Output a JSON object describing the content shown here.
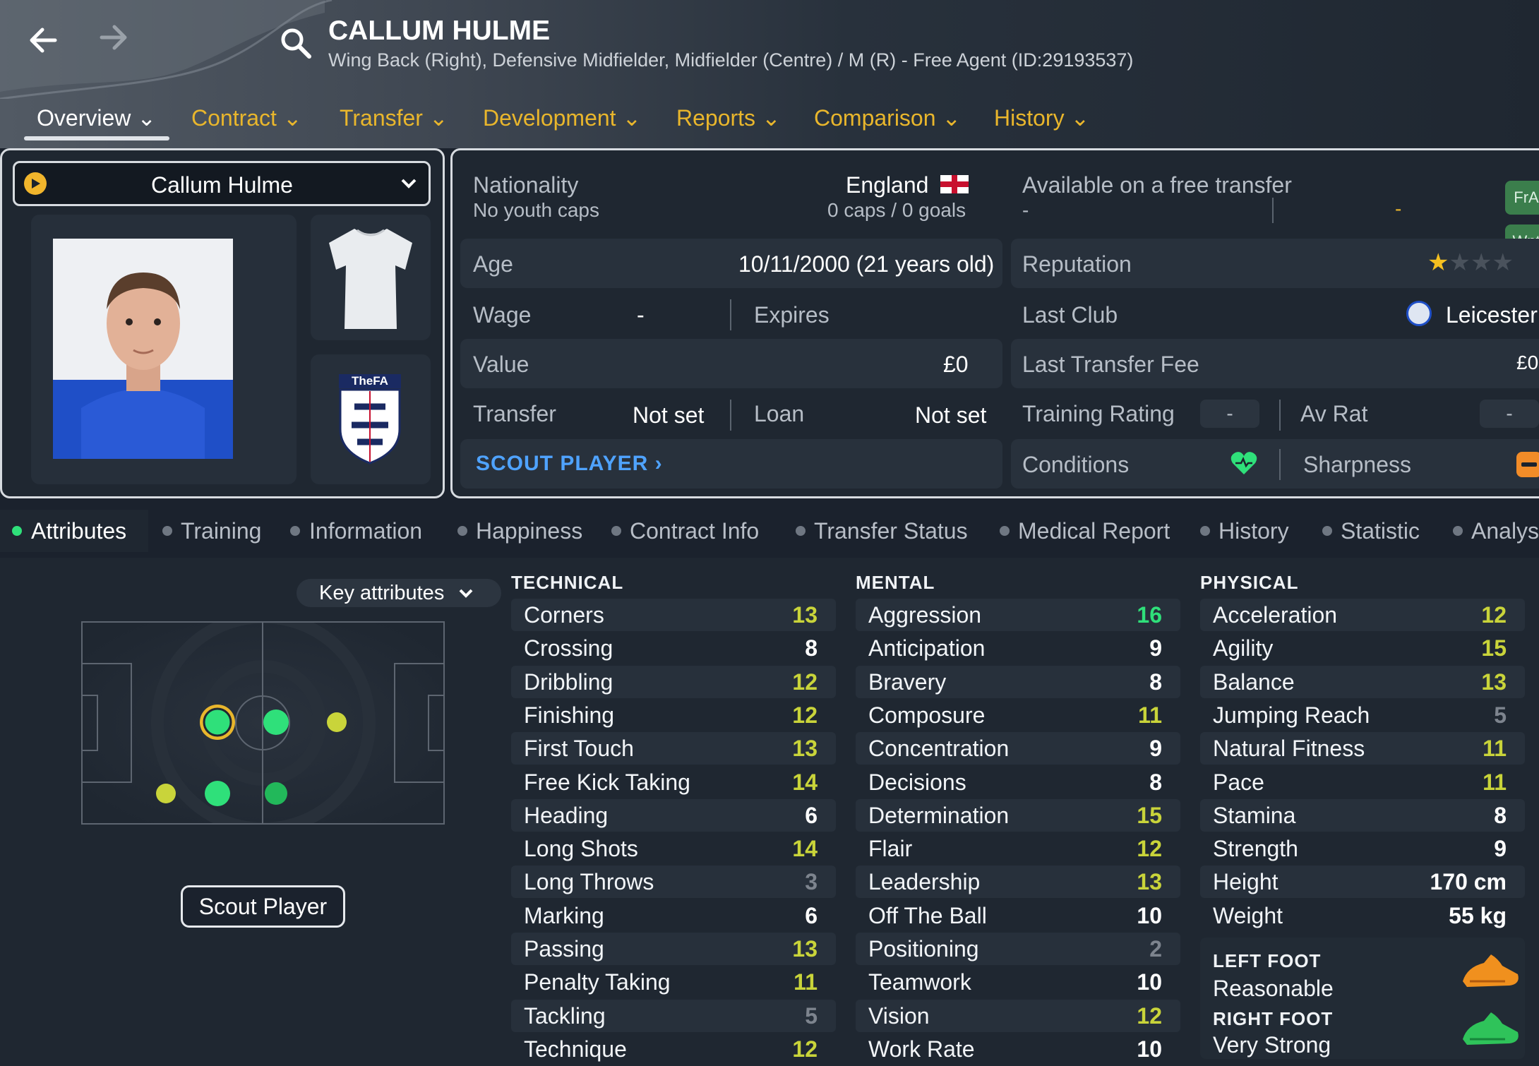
{
  "nav": {
    "back_icon": "arrow-left-icon",
    "forward_icon": "arrow-right-icon",
    "search_icon": "search-icon"
  },
  "header": {
    "name": "CALLUM HULME",
    "subtitle": "Wing Back (Right), Defensive Midfielder, Midfielder (Centre) / M (R) - Free Agent (ID:29193537)"
  },
  "tabs": [
    "Overview",
    "Contract",
    "Transfer",
    "Development",
    "Reports",
    "Comparison",
    "History"
  ],
  "player_card": {
    "dropdown_name": "Callum Hulme",
    "badge_text": "TheFA"
  },
  "info": {
    "nationality_label": "Nationality",
    "youth_caps": "No youth caps",
    "country": "England",
    "caps": "0 caps / 0 goals",
    "age_label": "Age",
    "age_value": "10/11/2000 (21 years old)",
    "wage_label": "Wage",
    "wage_value": "-",
    "expires_label": "Expires",
    "value_label": "Value",
    "value_value": "£0",
    "transfer_label": "Transfer",
    "transfer_value": "Not set",
    "loan_label": "Loan",
    "loan_value": "Not set",
    "scout_link": "SCOUT PLAYER ›",
    "free_transfer": "Available on a free transfer",
    "free_dash": "-",
    "free_dash2": "-",
    "pill_1": "FrA",
    "pill_2": "Wnt",
    "reputation_label": "Reputation",
    "reputation_stars": 1,
    "last_club_label": "Last Club",
    "last_club_value": "Leicester",
    "last_fee_label": "Last Transfer Fee",
    "last_fee_value": "£0",
    "training_label": "Training Rating",
    "training_value": "-",
    "avrat_label": "Av Rat",
    "avrat_value": "-",
    "conditions_label": "Conditions",
    "sharpness_label": "Sharpness"
  },
  "subtabs": [
    "Attributes",
    "Training",
    "Information",
    "Happiness",
    "Contract Info",
    "Transfer Status",
    "Medical Report",
    "History",
    "Statistic",
    "Analys"
  ],
  "key_attributes_label": "Key attributes",
  "scout_button": "Scout Player",
  "attributes": {
    "technical_title": "TECHNICAL",
    "technical": [
      [
        "Corners",
        "13"
      ],
      [
        "Crossing",
        "8"
      ],
      [
        "Dribbling",
        "12"
      ],
      [
        "Finishing",
        "12"
      ],
      [
        "First Touch",
        "13"
      ],
      [
        "Free Kick Taking",
        "14"
      ],
      [
        "Heading",
        "6"
      ],
      [
        "Long Shots",
        "14"
      ],
      [
        "Long Throws",
        "3"
      ],
      [
        "Marking",
        "6"
      ],
      [
        "Passing",
        "13"
      ],
      [
        "Penalty Taking",
        "11"
      ],
      [
        "Tackling",
        "5"
      ],
      [
        "Technique",
        "12"
      ]
    ],
    "mental_title": "MENTAL",
    "mental": [
      [
        "Aggression",
        "16"
      ],
      [
        "Anticipation",
        "9"
      ],
      [
        "Bravery",
        "8"
      ],
      [
        "Composure",
        "11"
      ],
      [
        "Concentration",
        "9"
      ],
      [
        "Decisions",
        "8"
      ],
      [
        "Determination",
        "15"
      ],
      [
        "Flair",
        "12"
      ],
      [
        "Leadership",
        "13"
      ],
      [
        "Off The Ball",
        "10"
      ],
      [
        "Positioning",
        "2"
      ],
      [
        "Teamwork",
        "10"
      ],
      [
        "Vision",
        "12"
      ],
      [
        "Work Rate",
        "10"
      ]
    ],
    "physical_title": "PHYSICAL",
    "physical": [
      [
        "Acceleration",
        "12"
      ],
      [
        "Agility",
        "15"
      ],
      [
        "Balance",
        "13"
      ],
      [
        "Jumping Reach",
        "5"
      ],
      [
        "Natural Fitness",
        "11"
      ],
      [
        "Pace",
        "11"
      ],
      [
        "Stamina",
        "8"
      ],
      [
        "Strength",
        "9"
      ],
      [
        "Height",
        "170 cm"
      ],
      [
        "Weight",
        "55 kg"
      ]
    ],
    "left_foot_title": "LEFT FOOT",
    "left_foot_value": "Reasonable",
    "right_foot_title": "RIGHT FOOT",
    "right_foot_value": "Very Strong"
  },
  "colors": {
    "accent": "#e9b62c",
    "link": "#4fa3ff",
    "green": "#2fe07a",
    "yellowgreen": "#c9d43a",
    "white_val": "#ffffff",
    "low": "#7d848e"
  }
}
